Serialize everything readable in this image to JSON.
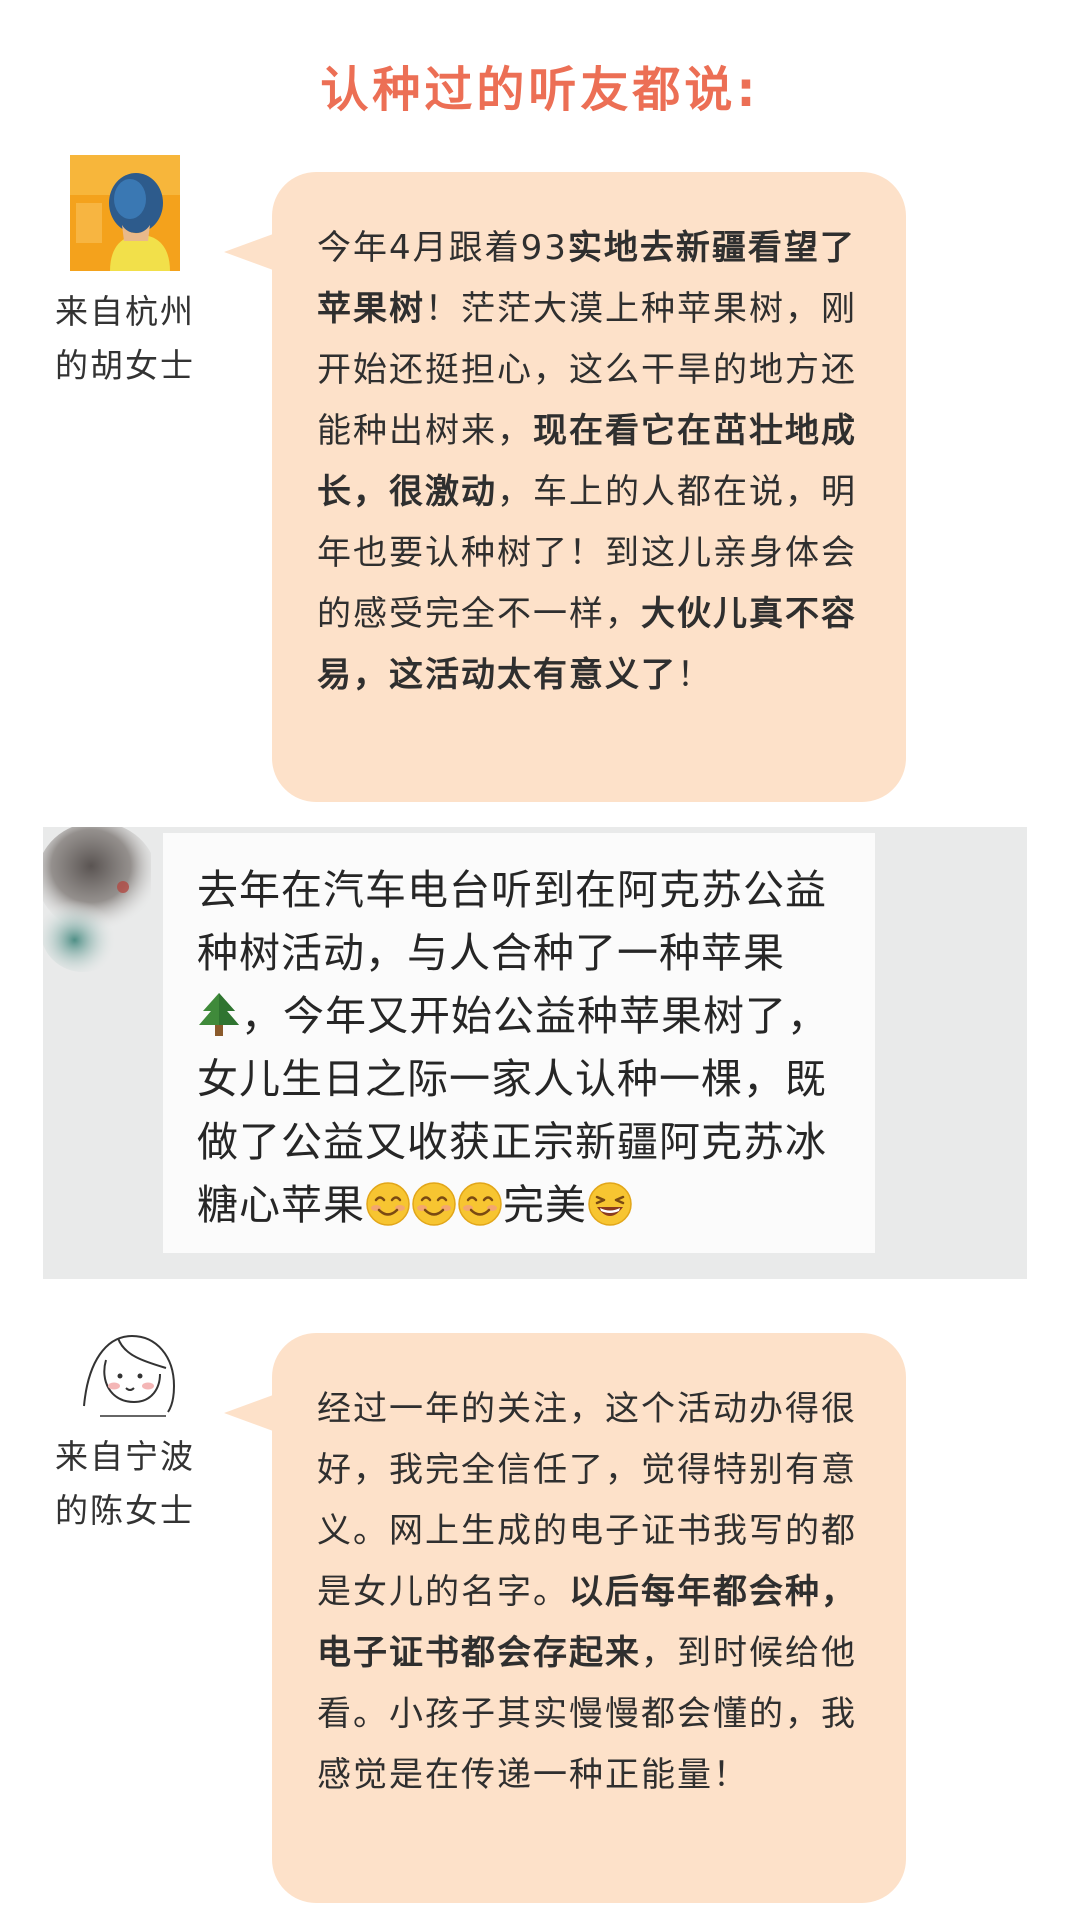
{
  "title": "认种过的听友都说:",
  "testimonials": [
    {
      "author_line1": "来自杭州",
      "author_line2": "的胡女士",
      "segments": [
        {
          "text": "今年4月跟着93",
          "bold": false
        },
        {
          "text": "实地去新疆看望了苹果树",
          "bold": true
        },
        {
          "text": "！茫茫大漠上种苹果树，刚开始还挺担心，这么干旱的地方还能种出树来，",
          "bold": false
        },
        {
          "text": "现在看它在茁壮地成长，很激动",
          "bold": true
        },
        {
          "text": "，车上的人都在说，明年也要认种树了！到这儿亲身体会的感受完全不一样，",
          "bold": false
        },
        {
          "text": "大伙儿真不容易，这活动太有意义了",
          "bold": true
        },
        {
          "text": "！",
          "bold": false
        }
      ]
    },
    {
      "author_line1": "来自宁波",
      "author_line2": "的陈女士",
      "segments": [
        {
          "text": "经过一年的关注，这个活动办得很好，我完全信任了，觉得特别有意义。网上生成的电子证书我写的都是女儿的名字。",
          "bold": false
        },
        {
          "text": "以后每年都会种，电子证书都会存起来",
          "bold": true
        },
        {
          "text": "，到时候给他看。小孩子其实慢慢都会懂的，我感觉是在传递一种正能量！",
          "bold": false
        }
      ]
    }
  ],
  "chat_message": {
    "line1": "去年在汽车电台听到在阿克苏公益",
    "line2": "种树活动，与人合种了一种苹果",
    "line3_after_emoji": "，今年又开始公益种苹果树了，",
    "line4": "女儿生日之际一家人认种一棵，既",
    "line5": "做了公益又收获正宗新疆阿克苏冰",
    "line6_text": "糖心苹果",
    "line6_suffix": "完美",
    "emojis": [
      "evergreen-tree",
      "smiling-face",
      "smiling-face",
      "smiling-face",
      "grinning-face"
    ]
  },
  "colors": {
    "title": "#ec6f55",
    "bubble": "#fde1c9",
    "chat_background": "#e9eaea",
    "chat_bubble": "#fbfbfb"
  }
}
